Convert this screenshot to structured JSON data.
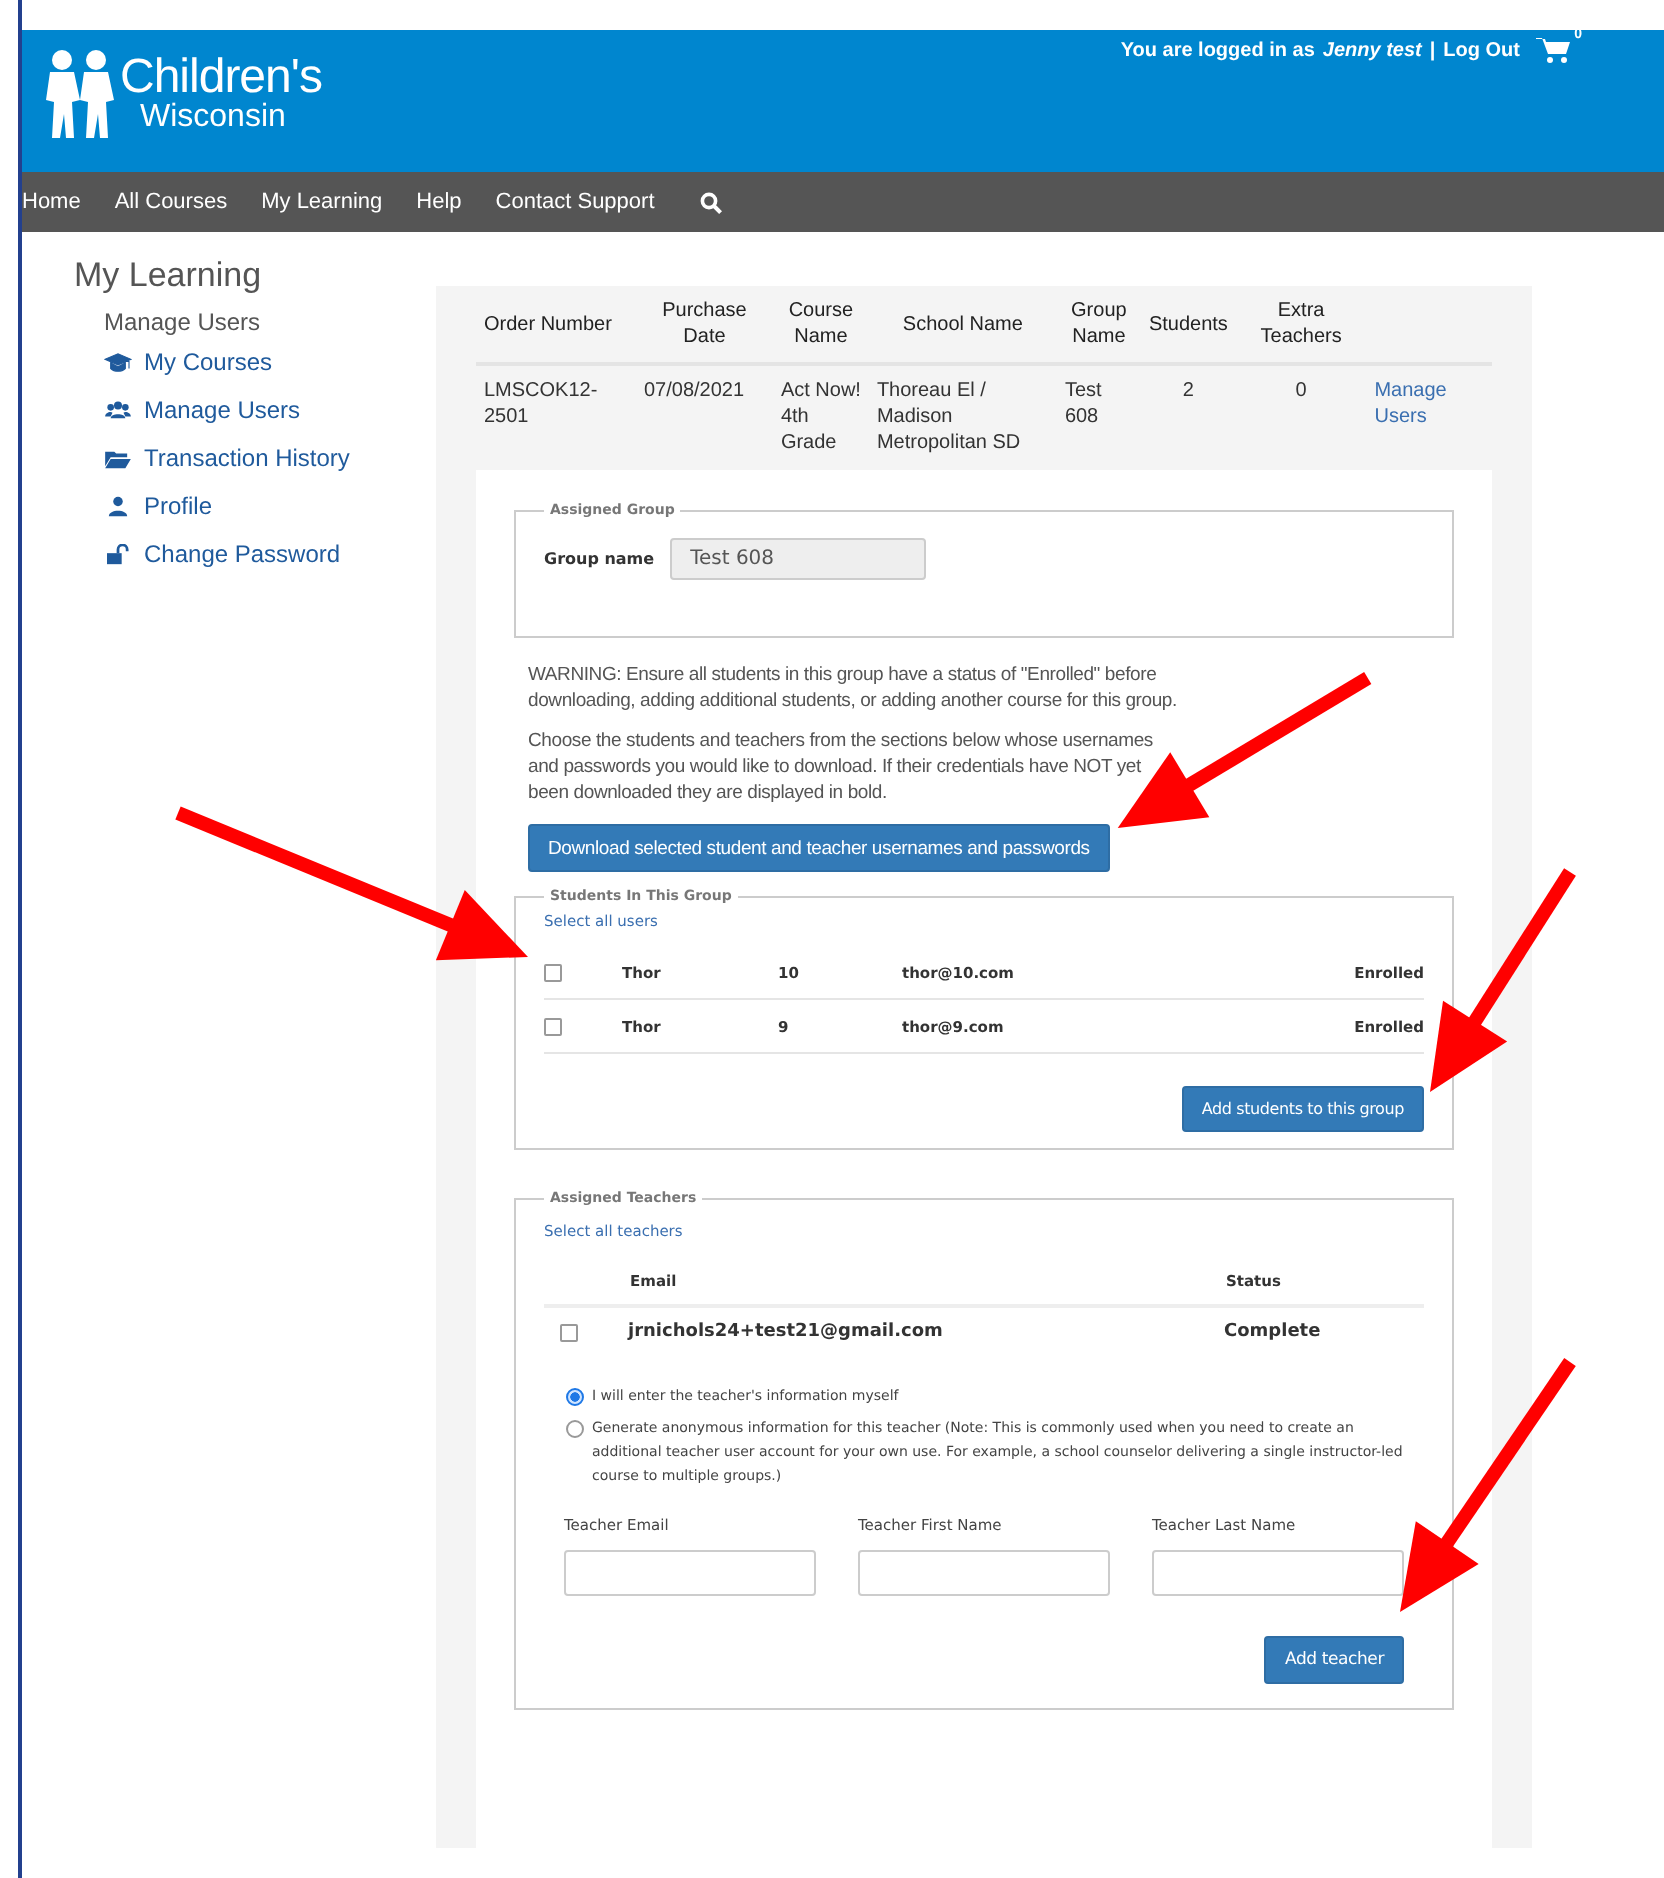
{
  "header": {
    "logo": {
      "line1": "Children's",
      "line2": "Wisconsin"
    },
    "login": {
      "prefix": "You are logged in as",
      "user": "Jenny test",
      "separator": "|",
      "logout": "Log Out"
    },
    "cart_count": "0"
  },
  "nav": {
    "items": [
      {
        "label": "Home"
      },
      {
        "label": "All Courses"
      },
      {
        "label": "My Learning"
      },
      {
        "label": "Help"
      },
      {
        "label": "Contact Support"
      }
    ]
  },
  "sidebar": {
    "title": "My Learning",
    "subtitle": "Manage Users",
    "items": [
      {
        "label": "My Courses",
        "kind": "courses"
      },
      {
        "label": "Manage Users",
        "kind": "users"
      },
      {
        "label": "Transaction History",
        "kind": "history"
      },
      {
        "label": "Profile",
        "kind": "profile"
      },
      {
        "label": "Change Password",
        "kind": "password"
      }
    ]
  },
  "orders": {
    "columns": [
      "Order Number",
      "Purchase Date",
      "Course Name",
      "School Name",
      "Group Name",
      "Students",
      "Extra Teachers"
    ],
    "rows": [
      {
        "cells": [
          "LMSCOK12-2501",
          "07/08/2021",
          "Act Now! 4th Grade",
          "Thoreau El / Madison Metropolitan SD",
          "Test 608",
          "2",
          "0"
        ],
        "action": "Manage Users"
      }
    ]
  },
  "assigned_group": {
    "legend": "Assigned Group",
    "label": "Group name",
    "value": "Test 608"
  },
  "warning": "WARNING: Ensure all students in this group have a status of \"Enrolled\" before downloading, adding additional students, or adding another course for this group.",
  "instructions": "Choose the students and teachers from the sections below whose usernames and passwords you would like to download. If their credentials have NOT yet been downloaded they are displayed in bold.",
  "download_button": {
    "label": "Download selected student and teacher usernames and passwords",
    "annotated": true
  },
  "students": {
    "legend": "Students In This Group",
    "select_all": "Select all users",
    "rows": [
      {
        "first": "Thor",
        "last": "10",
        "email": "thor@10.com",
        "status": "Enrolled",
        "checked": false,
        "annotated": true
      },
      {
        "first": "Thor",
        "last": "9",
        "email": "thor@9.com",
        "status": "Enrolled",
        "checked": false,
        "annotated": false
      }
    ],
    "add_button": {
      "label": "Add students to this group",
      "annotated": true
    }
  },
  "teachers": {
    "legend": "Assigned Teachers",
    "select_all": "Select all teachers",
    "columns": [
      "Email",
      "Status"
    ],
    "rows": [
      {
        "email": "jrnichols24+test21@gmail.com",
        "status": "Complete",
        "checked": false
      }
    ],
    "options": [
      {
        "label": "I will enter the teacher's information myself",
        "selected": true
      },
      {
        "label": "Generate anonymous information for this teacher (Note: This is commonly used when you need to create an additional teacher user account for your own use. For example, a school counselor delivering a single instructor-led course to multiple groups.)",
        "selected": false
      }
    ],
    "fields": [
      {
        "label": "Teacher Email"
      },
      {
        "label": "Teacher First Name"
      },
      {
        "label": "Teacher Last Name"
      }
    ],
    "add_button": {
      "label": "Add teacher",
      "annotated": true
    }
  }
}
